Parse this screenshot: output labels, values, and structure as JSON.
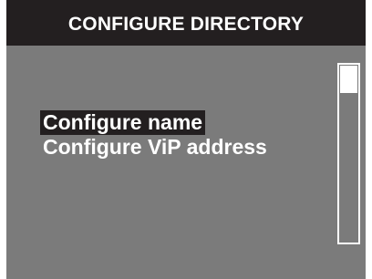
{
  "header": {
    "title": "CONFIGURE DIRECTORY"
  },
  "menu": {
    "items": [
      {
        "label": "Configure name",
        "selected": true
      },
      {
        "label": "Configure ViP address",
        "selected": false
      }
    ]
  },
  "colors": {
    "background": "#7b7b7b",
    "header": "#231f20",
    "text": "#ffffff",
    "selection": "#231f20"
  }
}
